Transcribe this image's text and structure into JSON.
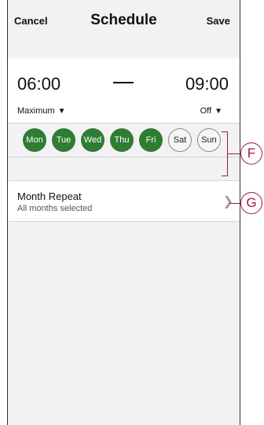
{
  "navbar": {
    "cancel_label": "Cancel",
    "title": "Schedule",
    "save_label": "Save"
  },
  "time_range": {
    "start_time": "06:00",
    "end_time": "09:00",
    "start_mode": "Maximum",
    "end_mode": "Off",
    "caret_icon": "▼"
  },
  "days": [
    {
      "label": "Mon",
      "selected": true
    },
    {
      "label": "Tue",
      "selected": true
    },
    {
      "label": "Wed",
      "selected": true
    },
    {
      "label": "Thu",
      "selected": true
    },
    {
      "label": "Fri",
      "selected": true
    },
    {
      "label": "Sat",
      "selected": false
    },
    {
      "label": "Sun",
      "selected": false
    }
  ],
  "month_repeat": {
    "title": "Month Repeat",
    "subtitle": "All months selected",
    "chevron_icon": "chevron-right-icon"
  },
  "callouts": {
    "days": "F",
    "month": "G"
  },
  "colors": {
    "accent": "#2e7d32",
    "callout": "#9d1a3a",
    "background": "#f2f2f4"
  }
}
